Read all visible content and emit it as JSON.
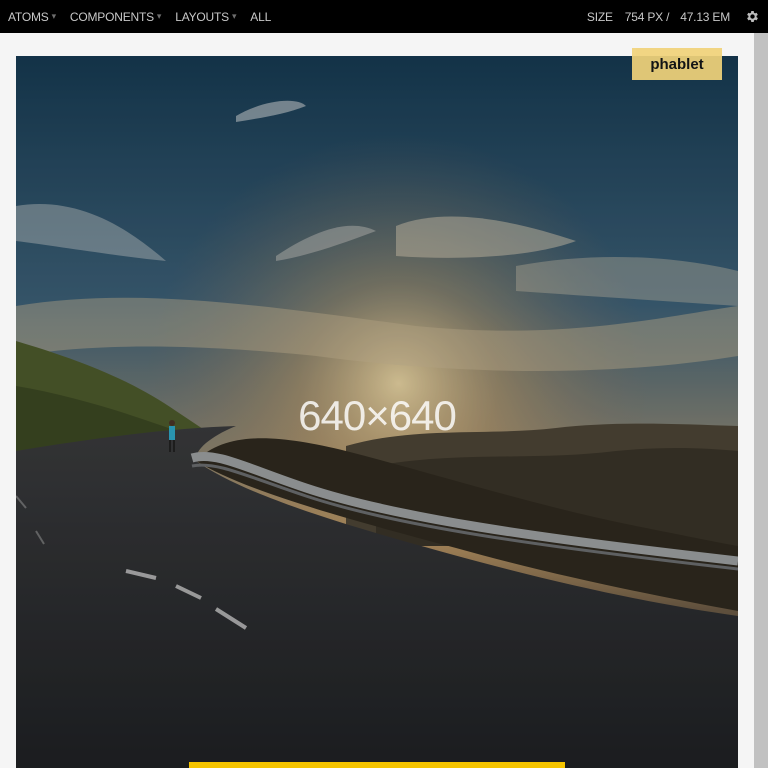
{
  "topbar": {
    "nav": [
      {
        "label": "ATOMS",
        "has_caret": true
      },
      {
        "label": "COMPONENTS",
        "has_caret": true
      },
      {
        "label": "LAYOUTS",
        "has_caret": true
      },
      {
        "label": "ALL",
        "has_caret": false
      }
    ],
    "caret_glyph": "▾",
    "size_label": "SIZE",
    "size_px": "754 PX /",
    "size_em": "47.13 EM",
    "settings_icon": "gear-icon"
  },
  "viewport": {
    "badge": "phablet",
    "image_placeholder": "640×640"
  },
  "colors": {
    "topbar_bg": "#000000",
    "badge_bg": "#f1d37a",
    "accent_bar": "#f5c400"
  }
}
